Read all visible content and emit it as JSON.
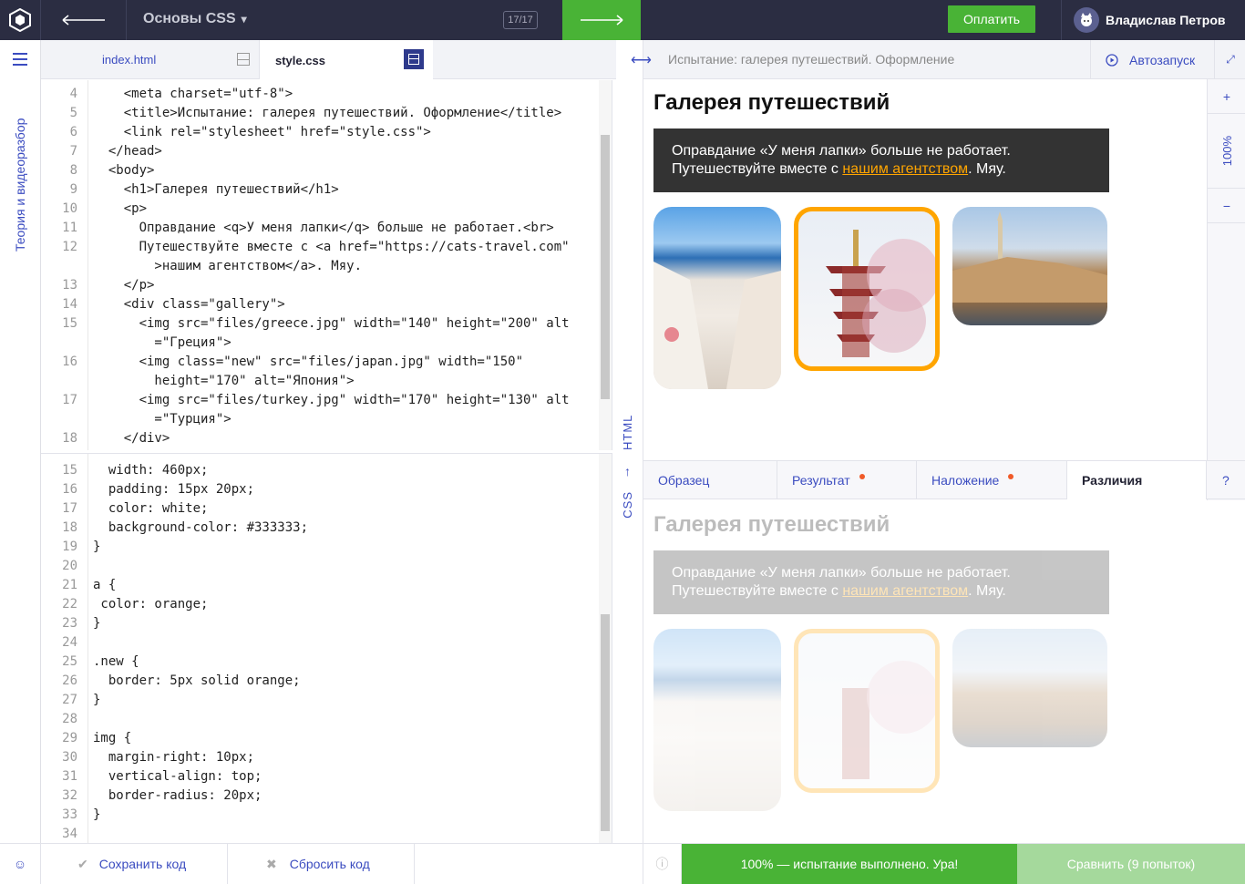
{
  "topbar": {
    "course_title": "Основы CSS",
    "progress": "17/17",
    "pay_label": "Оплатить",
    "user_name": "Владислав Петров"
  },
  "sidebar": {
    "title": "Теория и видеоразбор"
  },
  "editor_tabs": [
    {
      "label": "index.html"
    },
    {
      "label": "style.css"
    }
  ],
  "html_label": "HTML",
  "css_label": "CSS",
  "html_code": [
    {
      "n": "4",
      "t": "    <meta charset=\"utf-8\">"
    },
    {
      "n": "5",
      "t": "    <title>Испытание: галерея путешествий. Оформление</title>"
    },
    {
      "n": "6",
      "t": "    <link rel=\"stylesheet\" href=\"style.css\">"
    },
    {
      "n": "7",
      "t": "  </head>"
    },
    {
      "n": "8",
      "t": "  <body>"
    },
    {
      "n": "9",
      "t": "    <h1>Галерея путешествий</h1>"
    },
    {
      "n": "10",
      "t": "    <p>"
    },
    {
      "n": "11",
      "t": "      Оправдание <q>У меня лапки</q> больше не работает.<br>"
    },
    {
      "n": "12",
      "t": "      Путешествуйте вместе с <a href=\"https://cats-travel.com\""
    },
    {
      "n": "",
      "t": "        >нашим агентством</a>. Мяу."
    },
    {
      "n": "13",
      "t": "    </p>"
    },
    {
      "n": "14",
      "t": "    <div class=\"gallery\">"
    },
    {
      "n": "15",
      "t": "      <img src=\"files/greece.jpg\" width=\"140\" height=\"200\" alt"
    },
    {
      "n": "",
      "t": "        =\"Греция\">"
    },
    {
      "n": "16",
      "t": "      <img class=\"new\" src=\"files/japan.jpg\" width=\"150\""
    },
    {
      "n": "",
      "t": "        height=\"170\" alt=\"Япония\">"
    },
    {
      "n": "17",
      "t": "      <img src=\"files/turkey.jpg\" width=\"170\" height=\"130\" alt"
    },
    {
      "n": "",
      "t": "        =\"Турция\">"
    },
    {
      "n": "18",
      "t": "    </div>"
    }
  ],
  "css_code": [
    {
      "n": "15",
      "t": "  width: 460px;"
    },
    {
      "n": "16",
      "t": "  padding: 15px 20px;"
    },
    {
      "n": "17",
      "t": "  color: white;"
    },
    {
      "n": "18",
      "t": "  background-color: #333333;"
    },
    {
      "n": "19",
      "t": "}"
    },
    {
      "n": "20",
      "t": ""
    },
    {
      "n": "21",
      "t": "a {"
    },
    {
      "n": "22",
      "t": " color: orange;"
    },
    {
      "n": "23",
      "t": "}"
    },
    {
      "n": "24",
      "t": ""
    },
    {
      "n": "25",
      "t": ".new {"
    },
    {
      "n": "26",
      "t": "  border: 5px solid orange;"
    },
    {
      "n": "27",
      "t": "}"
    },
    {
      "n": "28",
      "t": ""
    },
    {
      "n": "29",
      "t": "img {"
    },
    {
      "n": "30",
      "t": "  margin-right: 10px;"
    },
    {
      "n": "31",
      "t": "  vertical-align: top;"
    },
    {
      "n": "32",
      "t": "  border-radius: 20px;"
    },
    {
      "n": "33",
      "t": "}"
    },
    {
      "n": "34",
      "t": ""
    }
  ],
  "preview": {
    "header_title": "Испытание: галерея путешествий. Оформление",
    "autorun_label": "Автозапуск",
    "zoom": "100%",
    "zoom_in": "+",
    "zoom_out": "−",
    "heading": "Галерея путешествий",
    "text_line1": "Оправдание «У меня лапки» больше не работает.",
    "text_line2_before": "Путешествуйте вместе с ",
    "text_link": "нашим агентством",
    "text_line2_after": ". Мяу."
  },
  "preview_tabs": [
    {
      "label": "Образец"
    },
    {
      "label": "Результат"
    },
    {
      "label": "Наложение"
    },
    {
      "label": "Различия"
    },
    {
      "label": "?"
    }
  ],
  "bottom": {
    "save_label": "Сохранить код",
    "reset_label": "Сбросить код",
    "success_label": "100% — испытание выполнено. Ура!",
    "compare_label": "Сравнить (9 попыток)"
  },
  "colors": {
    "accent": "#3b4cc0",
    "green": "#49b336",
    "dark": "#2b2d42",
    "orange": "#ffa500"
  }
}
